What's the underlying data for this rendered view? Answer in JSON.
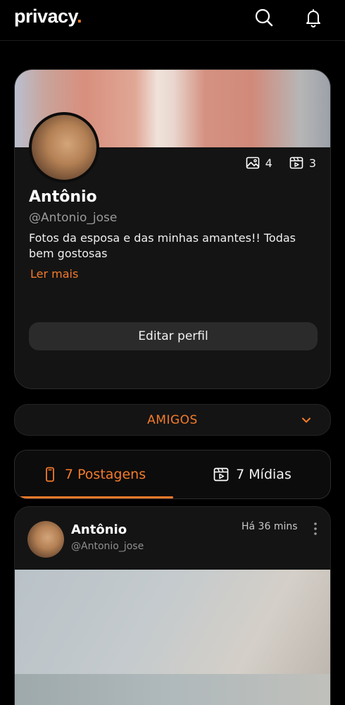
{
  "header": {
    "logo_text": "privacy",
    "logo_dot": ".",
    "search_icon": "search-icon",
    "notification_icon": "bell-icon"
  },
  "profile": {
    "name": "Antônio",
    "handle": "@Antonio_jose",
    "bio": "Fotos da esposa e das minhas amantes!! Todas bem gostosas",
    "read_more": "Ler mais",
    "photos_count": "4",
    "videos_count": "3",
    "edit_button": "Editar perfil"
  },
  "friends": {
    "label": "AMIGOS"
  },
  "tabs": [
    {
      "label": "7 Postagens",
      "icon": "phone-icon",
      "active": true
    },
    {
      "label": "7 Mídias",
      "icon": "media-icon",
      "active": false
    }
  ],
  "post": {
    "author": "Antônio",
    "handle": "@Antonio_jose",
    "time": "Há 36 mins"
  },
  "colors": {
    "accent": "#f47b2a",
    "background": "#000000",
    "card": "#141414"
  }
}
